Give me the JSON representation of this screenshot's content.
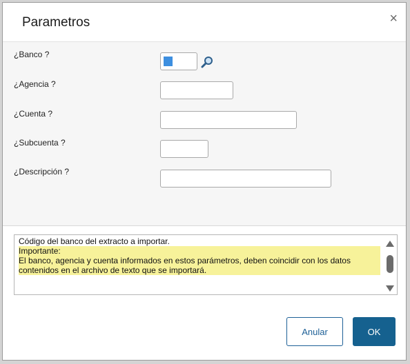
{
  "dialog": {
    "title": "Parametros",
    "close_glyph": "×"
  },
  "fields": {
    "banco": {
      "label": "¿Banco ?",
      "value": ""
    },
    "agencia": {
      "label": "¿Agencia ?",
      "value": ""
    },
    "cuenta": {
      "label": "¿Cuenta ?",
      "value": ""
    },
    "subcuenta": {
      "label": "¿Subcuenta ?",
      "value": ""
    },
    "descripcion": {
      "label": "¿Descripción ?",
      "value": ""
    }
  },
  "help": {
    "line1": "Código del banco del extracto a importar.",
    "line2": "Importante:",
    "line3": "El banco, agencia y cuenta informados en estos parámetros, deben coincidir con los datos contenidos en el archivo de texto que se importará."
  },
  "buttons": {
    "cancel_label": "Anular",
    "ok_label": "OK"
  },
  "icons": {
    "lookup": "magnifier-icon",
    "close": "close-icon"
  },
  "colors": {
    "primary": "#15618f",
    "highlight": "#f7f29a",
    "caret": "#3d8fe0"
  }
}
